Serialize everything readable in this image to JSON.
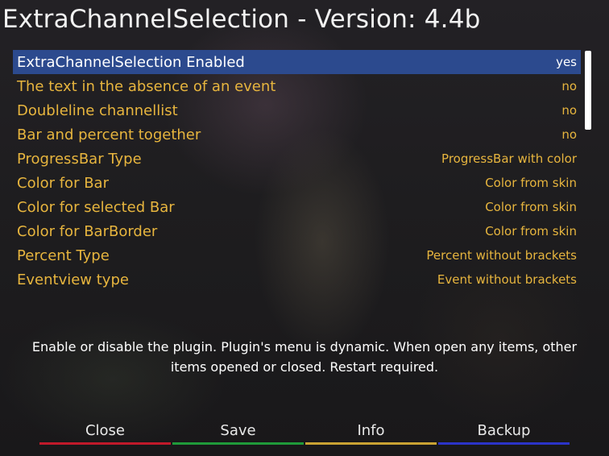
{
  "window": {
    "title": "ExtraChannelSelection - Version: 4.4b"
  },
  "settings": [
    {
      "label": "ExtraChannelSelection Enabled",
      "value": "yes",
      "selected": true
    },
    {
      "label": "The text in the absence of an event",
      "value": "no"
    },
    {
      "label": "Doubleline channellist",
      "value": "no"
    },
    {
      "label": "Bar and percent together",
      "value": "no"
    },
    {
      "label": "ProgressBar Type",
      "value": "ProgressBar with color"
    },
    {
      "label": "Color for Bar",
      "value": "Color from skin"
    },
    {
      "label": "Color for selected Bar",
      "value": "Color from skin"
    },
    {
      "label": "Color for BarBorder",
      "value": "Color from skin"
    },
    {
      "label": "Percent Type",
      "value": "Percent without brackets"
    },
    {
      "label": "Eventview type",
      "value": "Event without brackets"
    }
  ],
  "description": {
    "line1": "Enable or disable the plugin. Plugin's menu is dynamic. When open any items, other",
    "line2": "items opened or closed. Restart required."
  },
  "buttons": {
    "close": {
      "label": "Close",
      "color": "#c0192a"
    },
    "save": {
      "label": "Save",
      "color": "#1f9a3a"
    },
    "info": {
      "label": "Info",
      "color": "#c9a233"
    },
    "backup": {
      "label": "Backup",
      "color": "#2b33c8"
    }
  },
  "colors": {
    "selection": "#2c4a8e",
    "item_text": "#e7b53e",
    "selected_text": "#ffffff"
  }
}
